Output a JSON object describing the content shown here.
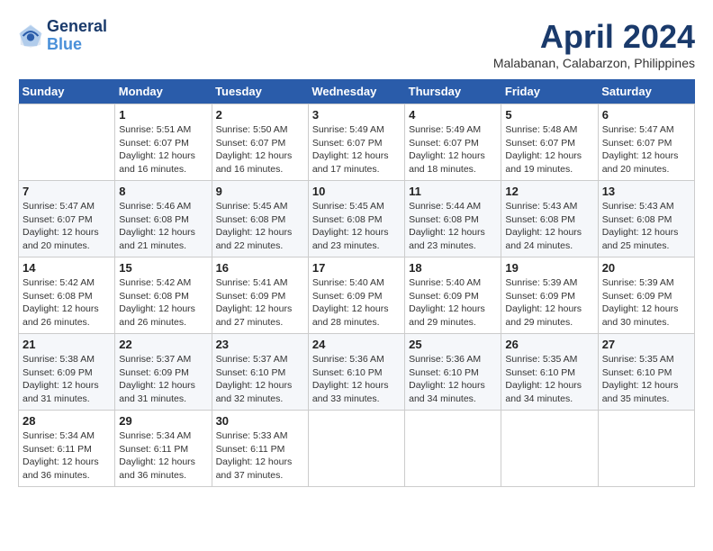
{
  "header": {
    "logo_line1": "General",
    "logo_line2": "Blue",
    "month": "April 2024",
    "location": "Malabanan, Calabarzon, Philippines"
  },
  "weekdays": [
    "Sunday",
    "Monday",
    "Tuesday",
    "Wednesday",
    "Thursday",
    "Friday",
    "Saturday"
  ],
  "weeks": [
    [
      null,
      {
        "day": 1,
        "sunrise": "5:51 AM",
        "sunset": "6:07 PM",
        "daylight": "12 hours and 16 minutes."
      },
      {
        "day": 2,
        "sunrise": "5:50 AM",
        "sunset": "6:07 PM",
        "daylight": "12 hours and 16 minutes."
      },
      {
        "day": 3,
        "sunrise": "5:49 AM",
        "sunset": "6:07 PM",
        "daylight": "12 hours and 17 minutes."
      },
      {
        "day": 4,
        "sunrise": "5:49 AM",
        "sunset": "6:07 PM",
        "daylight": "12 hours and 18 minutes."
      },
      {
        "day": 5,
        "sunrise": "5:48 AM",
        "sunset": "6:07 PM",
        "daylight": "12 hours and 19 minutes."
      },
      {
        "day": 6,
        "sunrise": "5:47 AM",
        "sunset": "6:07 PM",
        "daylight": "12 hours and 20 minutes."
      }
    ],
    [
      {
        "day": 7,
        "sunrise": "5:47 AM",
        "sunset": "6:07 PM",
        "daylight": "12 hours and 20 minutes."
      },
      {
        "day": 8,
        "sunrise": "5:46 AM",
        "sunset": "6:08 PM",
        "daylight": "12 hours and 21 minutes."
      },
      {
        "day": 9,
        "sunrise": "5:45 AM",
        "sunset": "6:08 PM",
        "daylight": "12 hours and 22 minutes."
      },
      {
        "day": 10,
        "sunrise": "5:45 AM",
        "sunset": "6:08 PM",
        "daylight": "12 hours and 23 minutes."
      },
      {
        "day": 11,
        "sunrise": "5:44 AM",
        "sunset": "6:08 PM",
        "daylight": "12 hours and 23 minutes."
      },
      {
        "day": 12,
        "sunrise": "5:43 AM",
        "sunset": "6:08 PM",
        "daylight": "12 hours and 24 minutes."
      },
      {
        "day": 13,
        "sunrise": "5:43 AM",
        "sunset": "6:08 PM",
        "daylight": "12 hours and 25 minutes."
      }
    ],
    [
      {
        "day": 14,
        "sunrise": "5:42 AM",
        "sunset": "6:08 PM",
        "daylight": "12 hours and 26 minutes."
      },
      {
        "day": 15,
        "sunrise": "5:42 AM",
        "sunset": "6:08 PM",
        "daylight": "12 hours and 26 minutes."
      },
      {
        "day": 16,
        "sunrise": "5:41 AM",
        "sunset": "6:09 PM",
        "daylight": "12 hours and 27 minutes."
      },
      {
        "day": 17,
        "sunrise": "5:40 AM",
        "sunset": "6:09 PM",
        "daylight": "12 hours and 28 minutes."
      },
      {
        "day": 18,
        "sunrise": "5:40 AM",
        "sunset": "6:09 PM",
        "daylight": "12 hours and 29 minutes."
      },
      {
        "day": 19,
        "sunrise": "5:39 AM",
        "sunset": "6:09 PM",
        "daylight": "12 hours and 29 minutes."
      },
      {
        "day": 20,
        "sunrise": "5:39 AM",
        "sunset": "6:09 PM",
        "daylight": "12 hours and 30 minutes."
      }
    ],
    [
      {
        "day": 21,
        "sunrise": "5:38 AM",
        "sunset": "6:09 PM",
        "daylight": "12 hours and 31 minutes."
      },
      {
        "day": 22,
        "sunrise": "5:37 AM",
        "sunset": "6:09 PM",
        "daylight": "12 hours and 31 minutes."
      },
      {
        "day": 23,
        "sunrise": "5:37 AM",
        "sunset": "6:10 PM",
        "daylight": "12 hours and 32 minutes."
      },
      {
        "day": 24,
        "sunrise": "5:36 AM",
        "sunset": "6:10 PM",
        "daylight": "12 hours and 33 minutes."
      },
      {
        "day": 25,
        "sunrise": "5:36 AM",
        "sunset": "6:10 PM",
        "daylight": "12 hours and 34 minutes."
      },
      {
        "day": 26,
        "sunrise": "5:35 AM",
        "sunset": "6:10 PM",
        "daylight": "12 hours and 34 minutes."
      },
      {
        "day": 27,
        "sunrise": "5:35 AM",
        "sunset": "6:10 PM",
        "daylight": "12 hours and 35 minutes."
      }
    ],
    [
      {
        "day": 28,
        "sunrise": "5:34 AM",
        "sunset": "6:11 PM",
        "daylight": "12 hours and 36 minutes."
      },
      {
        "day": 29,
        "sunrise": "5:34 AM",
        "sunset": "6:11 PM",
        "daylight": "12 hours and 36 minutes."
      },
      {
        "day": 30,
        "sunrise": "5:33 AM",
        "sunset": "6:11 PM",
        "daylight": "12 hours and 37 minutes."
      },
      null,
      null,
      null,
      null
    ]
  ]
}
